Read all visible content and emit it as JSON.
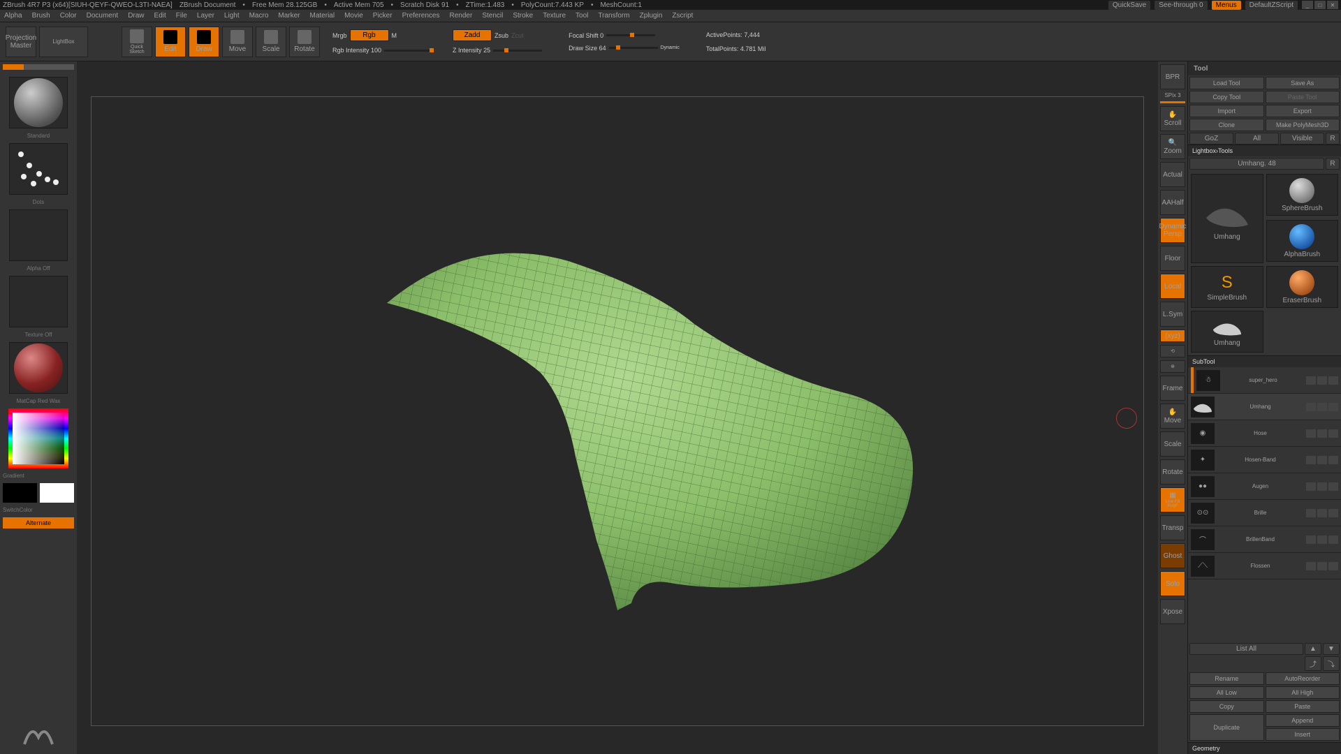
{
  "title": "ZBrush 4R7 P3 (x64)[SIUH-QEYF-QWEO-L3TI-NAEA]",
  "doc_title": "ZBrush Document",
  "stats": {
    "free_mem": "Free Mem 28.125GB",
    "active_mem": "Active Mem 705",
    "scratch": "Scratch Disk 91",
    "ztime": "ZTime:1.483",
    "polycount": "PolyCount:7.443 KP",
    "meshcount": "MeshCount:1"
  },
  "topright": {
    "quicksave": "QuickSave",
    "seethrough": "See-through  0",
    "menus": "Menus",
    "script": "DefaultZScript"
  },
  "menus": [
    "Alpha",
    "Brush",
    "Color",
    "Document",
    "Draw",
    "Edit",
    "File",
    "Layer",
    "Light",
    "Macro",
    "Marker",
    "Material",
    "Movie",
    "Picker",
    "Preferences",
    "Render",
    "Stencil",
    "Stroke",
    "Texture",
    "Tool",
    "Transform",
    "Zplugin",
    "Zscript"
  ],
  "toolbar": {
    "proj_master": "Projection\nMaster",
    "lightbox": "LightBox",
    "quicksketch": "Quick\nSketch",
    "edit": "Edit",
    "draw": "Draw",
    "move": "Move",
    "scale": "Scale",
    "rotate": "Rotate",
    "mrgb": "Mrgb",
    "rgb": "Rgb",
    "m_mod": "M",
    "rgb_intensity": "Rgb Intensity 100",
    "zadd": "Zadd",
    "zsub": "Zsub",
    "zcut": "Zcut",
    "z_intensity": "Z Intensity 25",
    "focal": "Focal Shift 0",
    "draw_size": "Draw Size 64",
    "dynamic": "Dynamic",
    "active_pts": "ActivePoints: 7,444",
    "total_pts": "TotalPoints: 4.781 Mil"
  },
  "left": {
    "brush": "Standard",
    "stroke": "Dots",
    "alpha": "Alpha Off",
    "texture": "Texture Off",
    "material": "MatCap Red Wax",
    "gradient": "Gradient",
    "switch": "SwitchColor",
    "alternate": "Alternate"
  },
  "ribbon": [
    "BPR",
    "SPix 3",
    "Scroll",
    "Zoom",
    "Actual",
    "AAHalf",
    "Dynamic\nPersp",
    "Floor",
    "Local",
    "L.Sym",
    "(xyz)",
    "",
    "",
    "Frame",
    "Move",
    "Scale",
    "Rotate",
    "Line Fill\nPolyF",
    "Transp",
    "Ghost",
    "Solo",
    "Xpose"
  ],
  "tool": {
    "header": "Tool",
    "load": "Load Tool",
    "save": "Save As",
    "copy": "Copy Tool",
    "paste": "Paste Tool",
    "import": "Import",
    "export": "Export",
    "clone": "Clone",
    "polymesh": "Make PolyMesh3D",
    "goz": "GoZ",
    "all": "All",
    "visible": "Visible",
    "r": "R",
    "lbtools": "Lightbox›Tools",
    "current": "Umhang. 48",
    "thumbs": [
      "Umhang",
      "SphereBrush",
      "AlphaBrush",
      "SimpleBrush",
      "EraserBrush",
      "Umhang"
    ],
    "subtool_h": "SubTool",
    "subtools": [
      "super_hero",
      "Umhang",
      "Hose",
      "Hosen-Band",
      "Augen",
      "Brille",
      "BrillenBand",
      "Flossen"
    ],
    "listall": "List All",
    "rename": "Rename",
    "autoreorder": "AutoReorder",
    "alllow": "All Low",
    "allhigh": "All High",
    "copy2": "Copy",
    "paste2": "Paste",
    "duplicate": "Duplicate",
    "append": "Append",
    "insert": "Insert",
    "geometry": "Geometry"
  }
}
